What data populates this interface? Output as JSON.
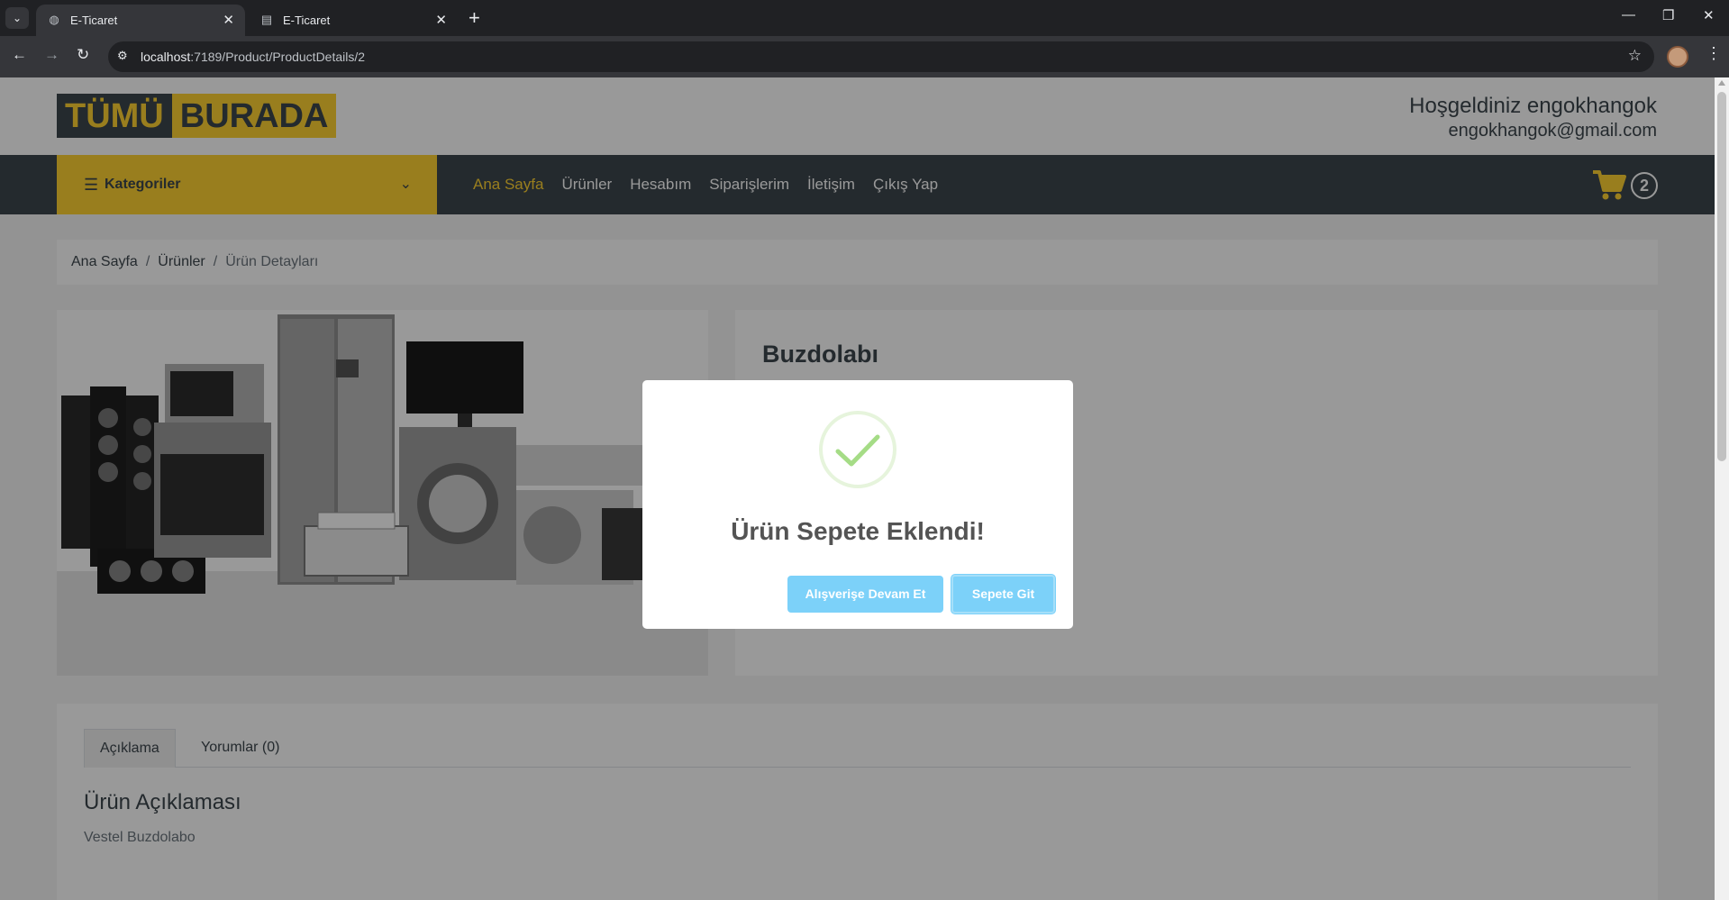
{
  "browser": {
    "tabs": [
      {
        "title": "E-Ticaret",
        "active": true
      },
      {
        "title": "E-Ticaret",
        "active": false
      }
    ],
    "url_host": "localhost",
    "url_path": ":7189/Product/ProductDetails/2"
  },
  "header": {
    "logo_part1": "TÜMÜ",
    "logo_part2": "BURADA",
    "welcome": "Hoşgeldiniz engokhangok",
    "email": "engokhangok@gmail.com"
  },
  "navbar": {
    "categories_label": "Kategoriler",
    "menu": [
      "Ana Sayfa",
      "Ürünler",
      "Hesabım",
      "Siparişlerim",
      "İletişim",
      "Çıkış Yap"
    ],
    "cart_count": "2"
  },
  "breadcrumb": {
    "items": [
      "Ana Sayfa",
      "Ürünler",
      "Ürün Detayları"
    ]
  },
  "product": {
    "name": "Buzdolabı"
  },
  "description": {
    "tabs": [
      "Açıklama",
      "Yorumlar (0)"
    ],
    "title": "Ürün Açıklaması",
    "text": "Vestel Buzdolabo"
  },
  "modal": {
    "title": "Ürün Sepete Eklendi!",
    "continue_label": "Alışverişe Devam Et",
    "cart_label": "Sepete Git"
  },
  "colors": {
    "accent": "#ffd333",
    "dark": "#3d464d",
    "modal_button": "#7cd1f9",
    "success": "#a5dc86"
  }
}
